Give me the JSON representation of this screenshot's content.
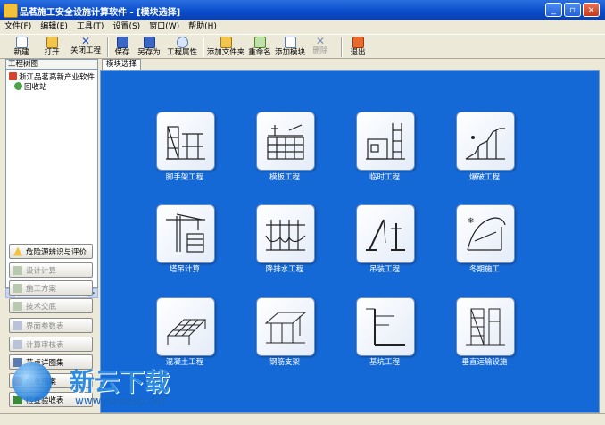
{
  "window": {
    "title": "品茗施工安全设施计算软件 - [模块选择]",
    "buttons": {
      "minimize": "_",
      "restore": "▫",
      "close": "×"
    }
  },
  "menu": [
    "文件(F)",
    "编辑(E)",
    "工具(T)",
    "设置(S)",
    "窗口(W)",
    "帮助(H)"
  ],
  "toolbar": [
    {
      "label": "新建",
      "icon": "new-file-icon",
      "enabled": true
    },
    {
      "label": "打开",
      "icon": "open-folder-icon",
      "enabled": true
    },
    {
      "label": "关闭工程",
      "icon": "close-x-icon",
      "enabled": true
    },
    {
      "label": "保存",
      "icon": "save-disk-icon",
      "enabled": true
    },
    {
      "label": "另存为",
      "icon": "save-as-icon",
      "enabled": true
    },
    {
      "label": "工程属性",
      "icon": "info-icon",
      "enabled": true
    },
    {
      "label": "添加文件夹",
      "icon": "add-folder-icon",
      "enabled": true
    },
    {
      "label": "重命名",
      "icon": "rename-icon",
      "enabled": true
    },
    {
      "label": "添加模块",
      "icon": "add-module-icon",
      "enabled": true
    },
    {
      "label": "删除",
      "icon": "delete-icon",
      "enabled": false
    },
    {
      "label": "退出",
      "icon": "exit-icon",
      "enabled": true
    }
  ],
  "tree": {
    "header": "工程树图",
    "items": [
      {
        "label": "浙江品茗高新产业软件",
        "icon": "home-icon"
      },
      {
        "label": "回收站",
        "icon": "recycle-bin-icon"
      }
    ]
  },
  "side_buttons": [
    {
      "label": "危险源辨识与评价",
      "icon": "warning-icon",
      "enabled": true
    },
    {
      "label": "设计计算",
      "icon": "calc-icon",
      "enabled": false
    },
    {
      "label": "施工方案",
      "icon": "plan-icon",
      "enabled": false
    },
    {
      "label": "技术交底",
      "icon": "briefing-icon",
      "enabled": false
    },
    {
      "label": "界面参数表",
      "icon": "params-table-icon",
      "enabled": false
    },
    {
      "label": "计算审核表",
      "icon": "audit-table-icon",
      "enabled": false
    },
    {
      "label": "节点详图集",
      "icon": "detail-drawing-icon",
      "enabled": true
    },
    {
      "label": "应急预案",
      "icon": "emergency-icon",
      "enabled": true
    },
    {
      "label": "检查验收表",
      "icon": "checklist-icon",
      "enabled": true
    }
  ],
  "tab": "模块选择",
  "modules": [
    {
      "label": "脚手架工程",
      "icon": "scaffold-icon"
    },
    {
      "label": "模板工程",
      "icon": "formwork-icon"
    },
    {
      "label": "临时工程",
      "icon": "temporary-works-icon"
    },
    {
      "label": "爆破工程",
      "icon": "blasting-icon"
    },
    {
      "label": "塔吊计算",
      "icon": "tower-crane-icon"
    },
    {
      "label": "降排水工程",
      "icon": "dewatering-icon"
    },
    {
      "label": "吊装工程",
      "icon": "hoisting-icon"
    },
    {
      "label": "冬期施工",
      "icon": "winter-construction-icon"
    },
    {
      "label": "混凝土工程",
      "icon": "concrete-icon"
    },
    {
      "label": "钢筋支架",
      "icon": "rebar-support-icon"
    },
    {
      "label": "基坑工程",
      "icon": "foundation-pit-icon"
    },
    {
      "label": "垂直运输设施",
      "icon": "vertical-transport-icon"
    }
  ],
  "watermark": {
    "text": "新云下载",
    "url": "www.newasp.net"
  },
  "colors": {
    "workspace": "#1569d6",
    "titlebar": "#0a4ccb"
  }
}
